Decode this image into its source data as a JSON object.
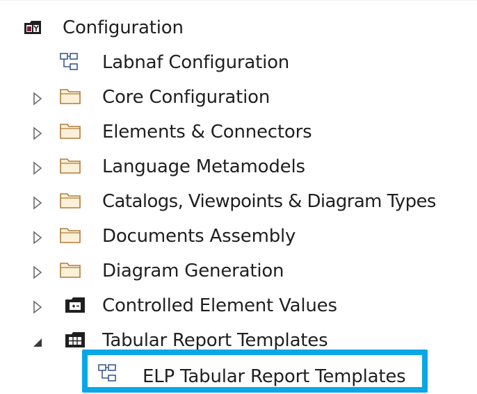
{
  "tree": {
    "root": {
      "label": "Configuration",
      "icon": "package-icon",
      "expanded": true
    },
    "items": [
      {
        "label": "Labnaf Configuration",
        "icon": "diagram-icon",
        "expandable": false
      },
      {
        "label": "Core Configuration",
        "icon": "folder-icon",
        "expandable": true,
        "expanded": false
      },
      {
        "label": "Elements & Connectors",
        "icon": "folder-icon",
        "expandable": true,
        "expanded": false
      },
      {
        "label": "Language Metamodels",
        "icon": "folder-icon",
        "expandable": true,
        "expanded": false
      },
      {
        "label": "Catalogs, Viewpoints & Diagram Types",
        "icon": "folder-icon",
        "expandable": true,
        "expanded": false
      },
      {
        "label": "Documents Assembly",
        "icon": "folder-icon",
        "expandable": true,
        "expanded": false
      },
      {
        "label": "Diagram Generation",
        "icon": "folder-icon",
        "expandable": true,
        "expanded": false
      },
      {
        "label": "Controlled Element Values",
        "icon": "package-plus-icon",
        "expandable": true,
        "expanded": false
      },
      {
        "label": "Tabular Report Templates",
        "icon": "package-table-icon",
        "expandable": true,
        "expanded": true
      },
      {
        "label": "ELP Tabular Report Templates",
        "icon": "diagram-icon",
        "expandable": false,
        "selected": true
      }
    ]
  },
  "colors": {
    "selection_border": "#0aa7e6",
    "folder_fill": "#fdf0d8",
    "folder_stroke": "#b07a3a",
    "diagram_stroke": "#3a5a8c",
    "package_fill": "#1f1f1f",
    "package_accent": "#7a1f3a"
  }
}
